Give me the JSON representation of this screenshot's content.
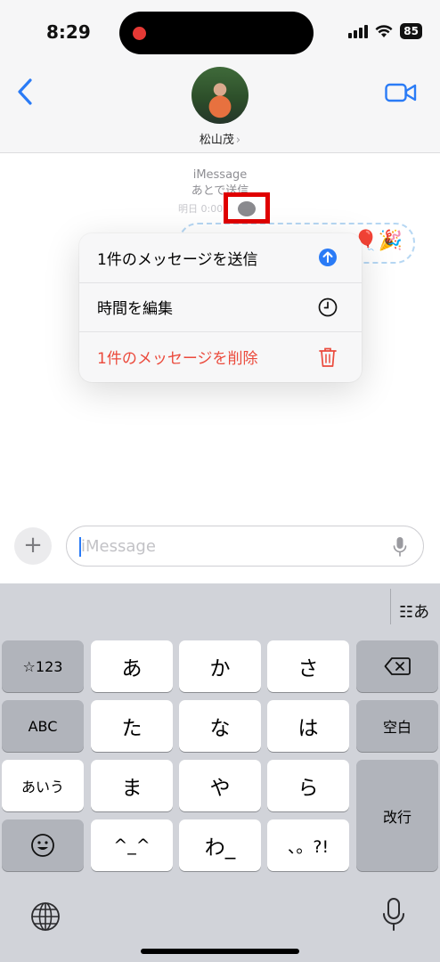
{
  "status_bar": {
    "time": "8:29",
    "battery": "85"
  },
  "nav": {
    "contact_name": "松山茂",
    "contact_chevron": "›"
  },
  "conversation": {
    "service_label": "iMessage",
    "scheduled_label": "あとで送信",
    "scheduled_time": "明日 0:00",
    "bubble_emoji": "🎈🎉"
  },
  "context_menu": {
    "items": [
      {
        "label": "1件のメッセージを送信",
        "icon": "send-arrow-up-icon"
      },
      {
        "label": "時間を編集",
        "icon": "clock-icon"
      },
      {
        "label": "1件のメッセージを削除",
        "icon": "trash-icon"
      }
    ]
  },
  "composer": {
    "plus": "+",
    "placeholder": "iMessage"
  },
  "keyboard": {
    "mode_label": "☷あ",
    "keys": {
      "num": "☆123",
      "a": "あ",
      "ka": "か",
      "sa": "さ",
      "abc": "ABC",
      "ta": "た",
      "na": "な",
      "ha": "は",
      "space": "空白",
      "aiu": "あいう",
      "ma": "ま",
      "ya": "や",
      "ra": "ら",
      "enter": "改行",
      "face": "^_^",
      "wa": "わ_",
      "punct": "、。?!"
    }
  },
  "colors": {
    "accent": "#2a7bf6",
    "destructive": "#eb4a3c",
    "highlight": "#e00000"
  }
}
